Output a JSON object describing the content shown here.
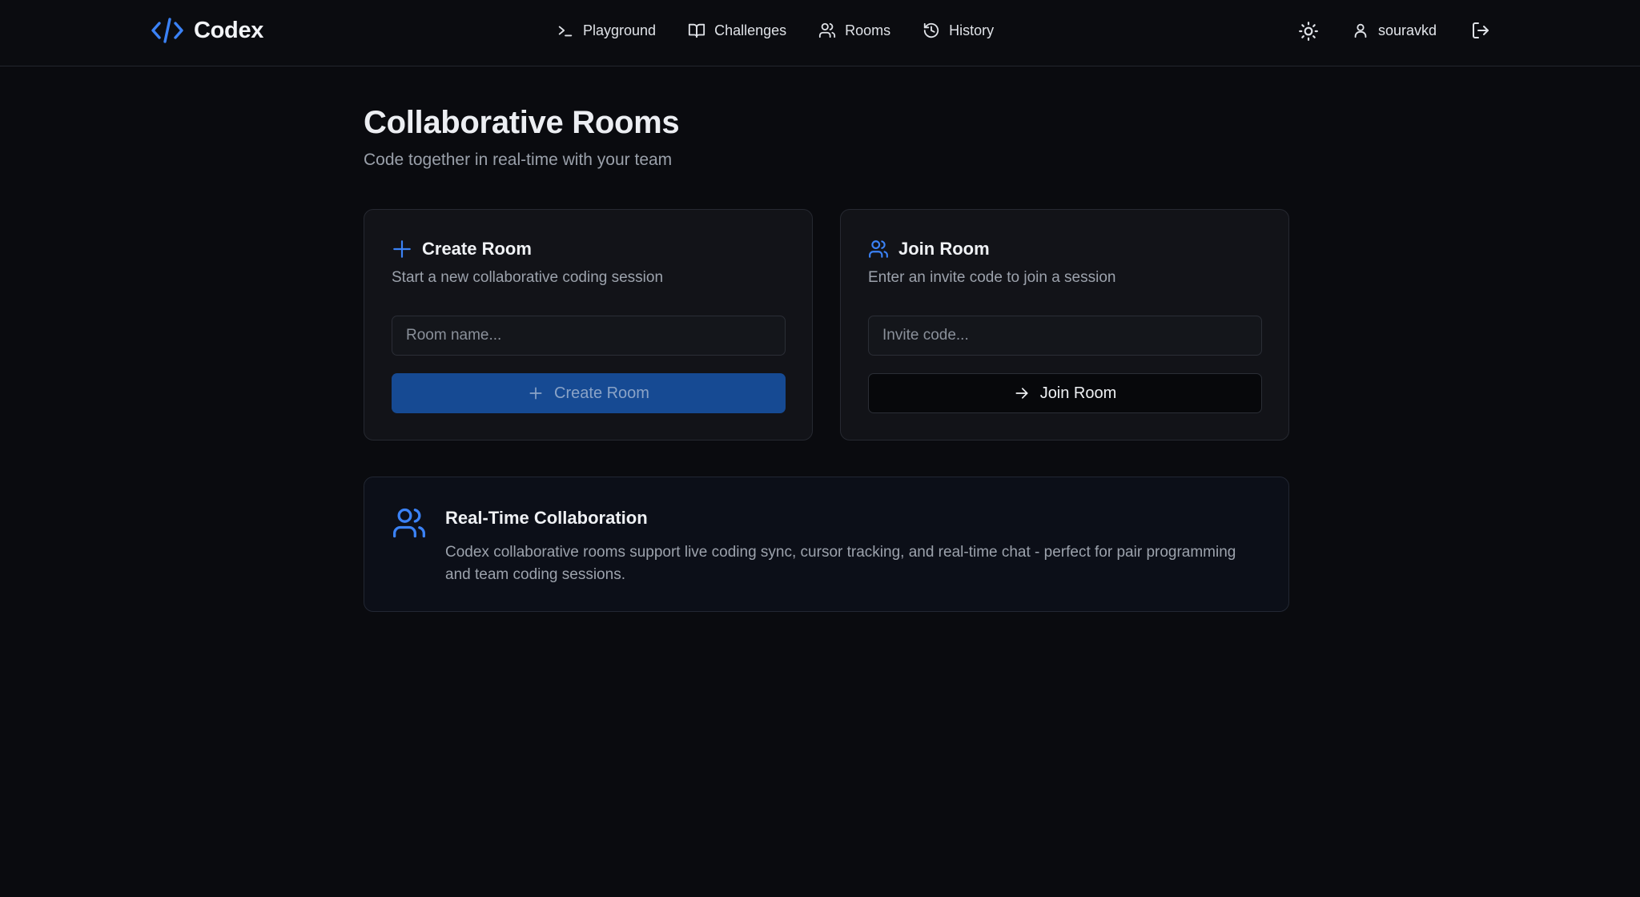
{
  "header": {
    "logo_text": "Codex",
    "nav": [
      {
        "label": "Playground",
        "icon": "terminal-icon"
      },
      {
        "label": "Challenges",
        "icon": "book-icon"
      },
      {
        "label": "Rooms",
        "icon": "users-icon"
      },
      {
        "label": "History",
        "icon": "history-icon"
      }
    ],
    "theme_icon": "sun-icon",
    "username": "souravkd",
    "logout_icon": "logout-icon"
  },
  "page": {
    "title": "Collaborative Rooms",
    "subtitle": "Code together in real-time with your team"
  },
  "create_room": {
    "title": "Create Room",
    "description": "Start a new collaborative coding session",
    "input_placeholder": "Room name...",
    "input_value": "",
    "button_label": "Create Room"
  },
  "join_room": {
    "title": "Join Room",
    "description": "Enter an invite code to join a session",
    "input_placeholder": "Invite code...",
    "input_value": "",
    "button_label": "Join Room"
  },
  "info": {
    "title": "Real-Time Collaboration",
    "text": "Codex collaborative rooms support live coding sync, cursor tracking, and real-time chat - perfect for pair programming and team coding sessions."
  },
  "colors": {
    "accent": "#3b82f6",
    "background": "#0a0b0f",
    "card": "#121318",
    "primary_button": "#164a93"
  }
}
